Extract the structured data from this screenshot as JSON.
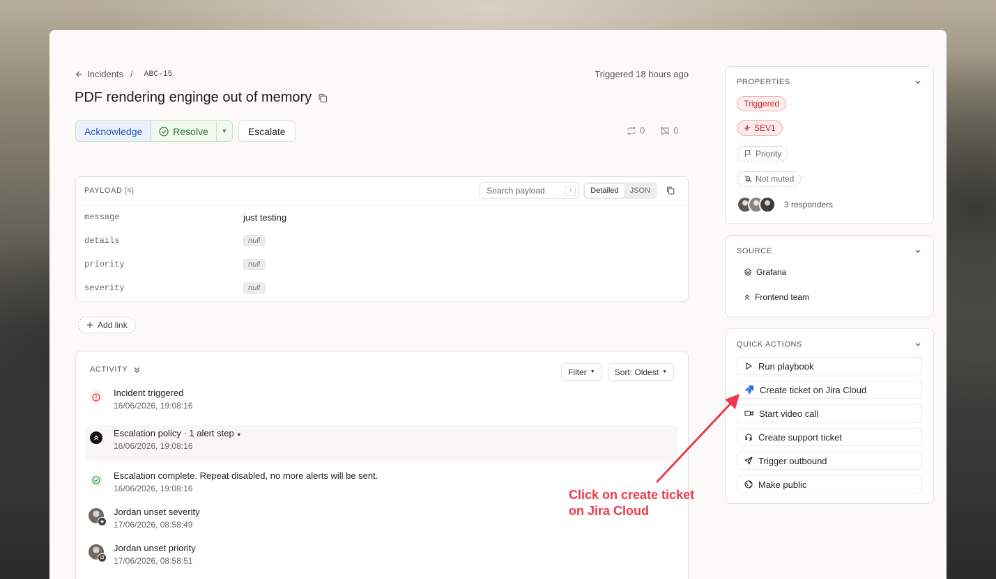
{
  "breadcrumb": {
    "parent": "Incidents",
    "separator": "/",
    "code": "ABC-15"
  },
  "triggered_text": "Triggered 18 hours ago",
  "title": "PDF rendering enginge out of memory",
  "actions": {
    "acknowledge": "Acknowledge",
    "resolve": "Resolve",
    "escalate": "Escalate"
  },
  "counters": {
    "reroutes": "0",
    "muted": "0"
  },
  "payload": {
    "label": "PAYLOAD",
    "count": "(4)",
    "search_placeholder": "Search payload",
    "search_shortcut": "/",
    "view_detailed": "Detailed",
    "view_json": "JSON",
    "rows": [
      {
        "key": "message",
        "value": "just testing"
      },
      {
        "key": "details",
        "value": "null"
      },
      {
        "key": "priority",
        "value": "null"
      },
      {
        "key": "severity",
        "value": "null"
      }
    ]
  },
  "add_link": "Add link",
  "activity": {
    "label": "ACTIVITY",
    "filter": "Filter",
    "sort": "Sort: Oldest",
    "events": [
      {
        "title": "Incident triggered",
        "date": "16/06/2026, 19:08:16"
      },
      {
        "title": "Escalation policy · 1 alert step",
        "date": "16/06/2026, 19:08:16"
      },
      {
        "title": "Escalation complete. Repeat disabled, no more alerts will be sent.",
        "date": "16/06/2026, 19:08:16"
      },
      {
        "title": "Jordan unset severity",
        "date": "17/06/2026, 08:58:49"
      },
      {
        "title": "Jordan unset priority",
        "date": "17/06/2026, 08:58:51"
      }
    ]
  },
  "properties": {
    "label": "PROPERTIES",
    "status": "Triggered",
    "severity": "SEV1",
    "priority": "Priority",
    "muted": "Not muted",
    "responders": "3 responders"
  },
  "source": {
    "label": "SOURCE",
    "integration": "Grafana",
    "team": "Frontend team"
  },
  "quick_actions": {
    "label": "QUICK ACTIONS",
    "items": [
      "Run playbook",
      "Create ticket on Jira Cloud",
      "Start video call",
      "Create support ticket",
      "Trigger outbound",
      "Make public"
    ]
  },
  "annotation": {
    "line1": "Click on create ticket",
    "line2": "on Jira Cloud"
  },
  "colors": {
    "accent_red": "#ec3a4b",
    "ack_blue": "#2a55b5",
    "resolve_green": "#2c7a35",
    "jira_blue": "#1868db"
  }
}
